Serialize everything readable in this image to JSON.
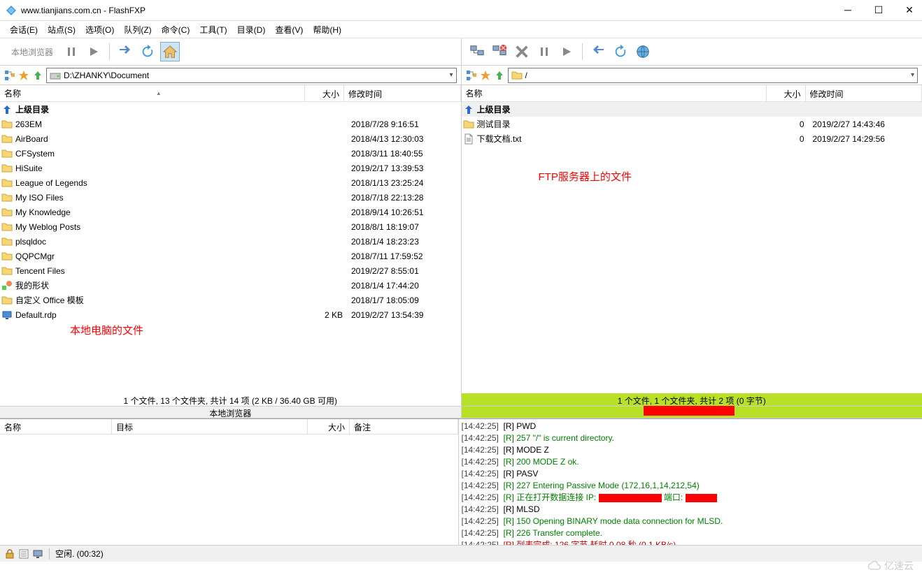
{
  "window": {
    "title": "www.tianjians.com.cn - FlashFXP"
  },
  "menubar": [
    {
      "label": "会话(E)"
    },
    {
      "label": "站点(S)"
    },
    {
      "label": "选项(O)"
    },
    {
      "label": "队列(Z)"
    },
    {
      "label": "命令(C)"
    },
    {
      "label": "工具(T)"
    },
    {
      "label": "目录(D)"
    },
    {
      "label": "查看(V)"
    },
    {
      "label": "帮助(H)"
    }
  ],
  "toolbar_left": {
    "label": "本地浏览器"
  },
  "path_left": {
    "value": "D:\\ZHANKY\\Document"
  },
  "path_right": {
    "value": "/"
  },
  "columns": {
    "name": "名称",
    "size": "大小",
    "date": "修改时间"
  },
  "left_files": {
    "parent": "上级目录",
    "rows": [
      {
        "icon": "folder",
        "name": "263EM",
        "size": "",
        "date": "2018/7/28 9:16:51"
      },
      {
        "icon": "folder",
        "name": "AirBoard",
        "size": "",
        "date": "2018/4/13 12:30:03"
      },
      {
        "icon": "folder",
        "name": "CFSystem",
        "size": "",
        "date": "2018/3/11 18:40:55"
      },
      {
        "icon": "folder",
        "name": "HiSuite",
        "size": "",
        "date": "2019/2/17 13:39:53"
      },
      {
        "icon": "folder",
        "name": "League of Legends",
        "size": "",
        "date": "2018/1/13 23:25:24"
      },
      {
        "icon": "folder",
        "name": "My ISO Files",
        "size": "",
        "date": "2018/7/18 22:13:28"
      },
      {
        "icon": "folder",
        "name": "My Knowledge",
        "size": "",
        "date": "2018/9/14 10:26:51"
      },
      {
        "icon": "folder",
        "name": "My Weblog Posts",
        "size": "",
        "date": "2018/8/1 18:19:07"
      },
      {
        "icon": "folder",
        "name": "plsqldoc",
        "size": "",
        "date": "2018/1/4 18:23:23"
      },
      {
        "icon": "folder",
        "name": "QQPCMgr",
        "size": "",
        "date": "2018/7/11 17:59:52"
      },
      {
        "icon": "folder",
        "name": "Tencent Files",
        "size": "",
        "date": "2019/2/27 8:55:01"
      },
      {
        "icon": "shapes",
        "name": "我的形状",
        "size": "",
        "date": "2018/1/4 17:44:20"
      },
      {
        "icon": "folder",
        "name": "自定义 Office 模板",
        "size": "",
        "date": "2018/1/7 18:05:09"
      },
      {
        "icon": "rdp",
        "name": "Default.rdp",
        "size": "2 KB",
        "date": "2019/2/27 13:54:39"
      }
    ],
    "summary": "1 个文件, 13 个文件夹, 共计 14 项 (2 KB / 36.40 GB 可用)",
    "browser_label": "本地浏览器",
    "annotation": "本地电脑的文件"
  },
  "right_files": {
    "parent": "上级目录",
    "rows": [
      {
        "icon": "folder",
        "name": "测试目录",
        "size": "0",
        "date": "2019/2/27 14:43:46"
      },
      {
        "icon": "txt",
        "name": "下载文档.txt",
        "size": "0",
        "date": "2019/2/27 14:29:56"
      }
    ],
    "summary": "1 个文件, 1 个文件夹, 共计 2 项 (0 字节)",
    "annotation": "FTP服务器上的文件"
  },
  "queue_columns": {
    "name": "名称",
    "target": "目标",
    "size": "大小",
    "note": "备注"
  },
  "log": [
    {
      "cls": "black",
      "ts": "[14:42:25]",
      "text": "[R] PWD"
    },
    {
      "cls": "green",
      "ts": "[14:42:25]",
      "text": "[R] 257 \"/\" is current directory."
    },
    {
      "cls": "black",
      "ts": "[14:42:25]",
      "text": "[R] MODE Z"
    },
    {
      "cls": "green",
      "ts": "[14:42:25]",
      "text": "[R] 200 MODE Z ok."
    },
    {
      "cls": "black",
      "ts": "[14:42:25]",
      "text": "[R] PASV"
    },
    {
      "cls": "green",
      "ts": "[14:42:25]",
      "text": "[R] 227 Entering Passive Mode (172,16,1,14,212,54)"
    },
    {
      "cls": "green",
      "ts": "[14:42:25]",
      "text": "[R] 正在打开数据连接 IP: ",
      "redact": true
    },
    {
      "cls": "black",
      "ts": "[14:42:25]",
      "text": "[R] MLSD"
    },
    {
      "cls": "green",
      "ts": "[14:42:25]",
      "text": "[R] 150 Opening BINARY mode data connection for MLSD."
    },
    {
      "cls": "green",
      "ts": "[14:42:25]",
      "text": "[R] 226 Transfer complete."
    },
    {
      "cls": "red",
      "ts": "[14:42:25]",
      "text": "[R] 列表完成: 126 字节 耗时 0.08 秒 (0.1 KB/s)"
    }
  ],
  "status": {
    "text": "空闲. (00:32)"
  },
  "watermark": "亿速云"
}
